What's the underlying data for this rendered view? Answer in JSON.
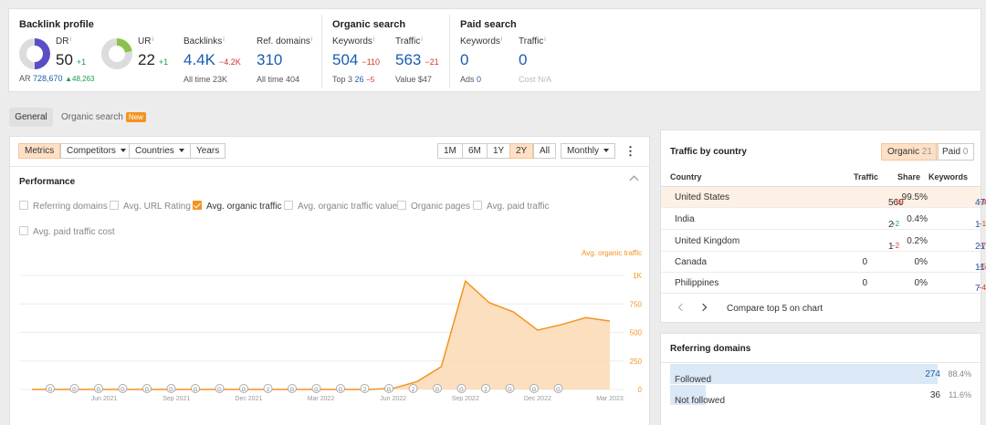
{
  "backlink": {
    "title": "Backlink profile",
    "dr": {
      "label": "DR",
      "value": "50",
      "delta": "+1"
    },
    "ar": {
      "label": "AR",
      "value": "728,670",
      "delta": "▲48,263"
    },
    "ur": {
      "label": "UR",
      "value": "22",
      "delta": "+1"
    },
    "backlinks": {
      "label": "Backlinks",
      "value": "4.4K",
      "delta": "−4.2K",
      "sub_label": "All time",
      "sub_value": "23K"
    },
    "ref_domains": {
      "label": "Ref. domains",
      "value": "310",
      "sub_label": "All time",
      "sub_value": "404"
    }
  },
  "organic": {
    "title": "Organic search",
    "keywords": {
      "label": "Keywords",
      "value": "504",
      "delta": "−110",
      "sub_label": "Top 3",
      "sub_value": "26",
      "sub_delta": "−5"
    },
    "traffic": {
      "label": "Traffic",
      "value": "563",
      "delta": "−21",
      "sub_label": "Value",
      "sub_value": "$47"
    }
  },
  "paid": {
    "title": "Paid search",
    "keywords": {
      "label": "Keywords",
      "value": "0",
      "sub_label": "Ads",
      "sub_value": "0"
    },
    "traffic": {
      "label": "Traffic",
      "value": "0",
      "sub_label": "Cost",
      "sub_value": "N/A"
    }
  },
  "tabs": {
    "general": "General",
    "organic": "Organic search",
    "new_badge": "New"
  },
  "toolbar": {
    "metrics": "Metrics",
    "competitors": "Competitors",
    "countries": "Countries",
    "years": "Years",
    "ranges": [
      "1M",
      "6M",
      "1Y",
      "2Y",
      "All"
    ],
    "active_range": "2Y",
    "interval": "Monthly",
    "more": "⋮"
  },
  "performance": {
    "title": "Performance",
    "checkboxes": [
      {
        "label": "Referring domains",
        "checked": false
      },
      {
        "label": "Avg. URL Rating",
        "checked": false
      },
      {
        "label": "Avg. organic traffic",
        "checked": true
      },
      {
        "label": "Avg. organic traffic value",
        "checked": false
      },
      {
        "label": "Organic pages",
        "checked": false
      },
      {
        "label": "Avg. paid traffic",
        "checked": false
      },
      {
        "label": "Avg. paid traffic cost",
        "checked": false
      }
    ]
  },
  "chart_data": {
    "type": "area",
    "series": [
      {
        "name": "Avg. organic traffic",
        "color": "#f2941f",
        "x": [
          "2021-03",
          "2021-04",
          "2021-05",
          "2021-06",
          "2021-07",
          "2021-08",
          "2021-09",
          "2021-10",
          "2021-11",
          "2021-12",
          "2022-01",
          "2022-02",
          "2022-03",
          "2022-04",
          "2022-05",
          "2022-06",
          "2022-07",
          "2022-08",
          "2022-09",
          "2022-10",
          "2022-11",
          "2022-12",
          "2023-01",
          "2023-02",
          "2023-03"
        ],
        "values": [
          0,
          0,
          0,
          0,
          0,
          0,
          0,
          0,
          0,
          0,
          0,
          0,
          0,
          0,
          0,
          10,
          70,
          200,
          950,
          760,
          680,
          520,
          570,
          630,
          600
        ]
      }
    ],
    "ylim": [
      0,
      1000
    ],
    "y_ticks": [
      "0",
      "250",
      "500",
      "750",
      "1K"
    ],
    "x_ticks": [
      "Jun 2021",
      "Sep 2021",
      "Dec 2021",
      "Mar 2022",
      "Jun 2022",
      "Sep 2022",
      "Dec 2022",
      "Mar 2023"
    ],
    "annotation_markers": [
      "G",
      "G",
      "G",
      "G",
      "G",
      "G",
      "G",
      "G",
      "G",
      "2",
      "G",
      "G",
      "G",
      "2",
      "G",
      "2",
      "G",
      "G",
      "2",
      "G",
      "G",
      "G"
    ],
    "grid": true
  },
  "country": {
    "title": "Traffic by country",
    "organic_tab": "Organic",
    "organic_count": "21",
    "paid_tab": "Paid",
    "paid_count": "0",
    "headers": [
      "Country",
      "Traffic",
      "Share",
      "Keywords"
    ],
    "rows": [
      {
        "country": "United States",
        "traffic": "560",
        "traffic_delta": "−19",
        "share": "99.5%",
        "keywords": "478",
        "keywords_delta": "−97"
      },
      {
        "country": "India",
        "traffic": "2",
        "traffic_delta": "+2",
        "share": "0.4%",
        "keywords": "1",
        "keywords_delta": "−1"
      },
      {
        "country": "United Kingdom",
        "traffic": "1",
        "traffic_delta": "−2",
        "share": "0.2%",
        "keywords": "21",
        "keywords_delta": "−7"
      },
      {
        "country": "Canada",
        "traffic": "0",
        "traffic_delta": "",
        "share": "0%",
        "keywords": "11",
        "keywords_delta": "−5"
      },
      {
        "country": "Philippines",
        "traffic": "0",
        "traffic_delta": "",
        "share": "0%",
        "keywords": "7",
        "keywords_delta": "−4"
      }
    ],
    "compare": "Compare top 5 on chart"
  },
  "refdomains": {
    "title": "Referring domains",
    "rows": [
      {
        "label": "Followed",
        "value": "274",
        "pct": "88.4%",
        "share": 0.884
      },
      {
        "label": "Not followed",
        "value": "36",
        "pct": "11.6%",
        "share": 0.116
      }
    ]
  }
}
